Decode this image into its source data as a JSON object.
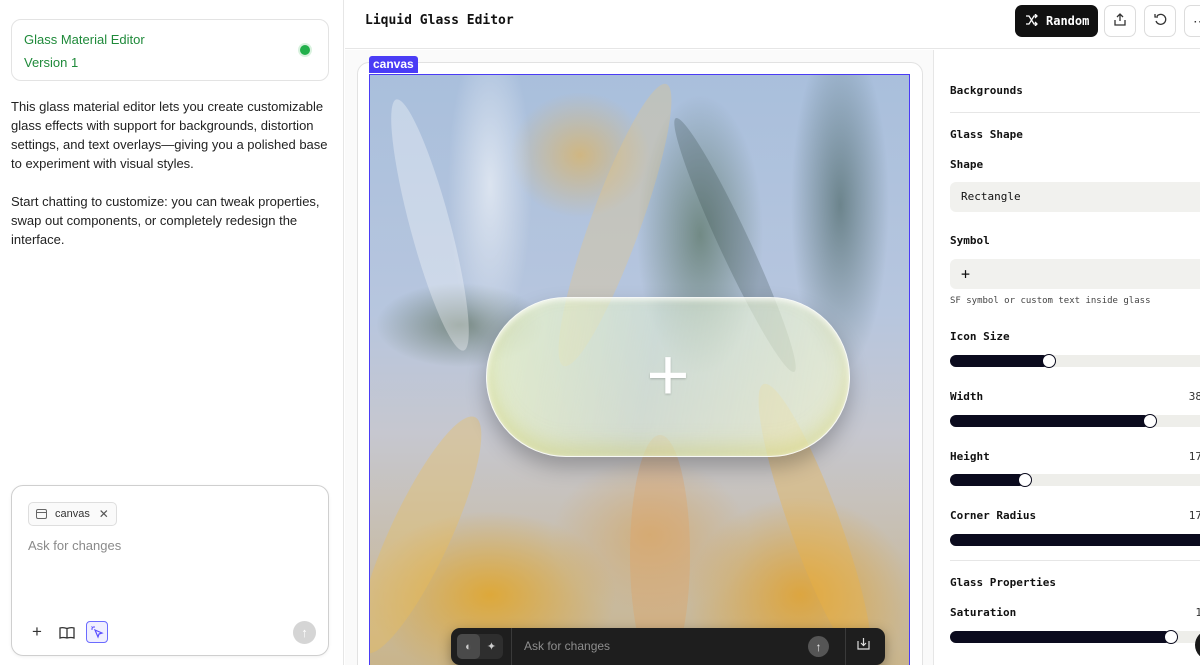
{
  "left": {
    "project_title": "Glass Material Editor",
    "project_version": "Version 1",
    "description_p1": "This glass material editor lets you create customizable glass effects with support for backgrounds, distortion settings, and text overlays—giving you a polished base to experiment with visual styles.",
    "description_p2": "Start chatting to customize: you can tweak properties, swap out components, or completely redesign the interface.",
    "chip_label": "canvas",
    "chat_placeholder": "Ask for changes",
    "status_color": "#22b04b"
  },
  "topbar": {
    "title": "Liquid Glass Editor",
    "random_label": "Random"
  },
  "canvas": {
    "tag": "canvas",
    "glass_symbol": "+",
    "float_placeholder": "Ask for changes"
  },
  "panel": {
    "backgrounds_title": "Backgrounds",
    "glass_shape_title": "Glass Shape",
    "shape_label": "Shape",
    "shape_value": "Rectangle",
    "symbol_label": "Symbol",
    "symbol_value": "+",
    "symbol_hint": "SF symbol or custom text inside glass",
    "icon_size_label": "Icon Size",
    "icon_size_fraction": 0.38,
    "width_label": "Width",
    "width_value": "38",
    "width_fraction": 0.77,
    "height_label": "Height",
    "height_value": "17",
    "height_fraction": 0.29,
    "corner_radius_label": "Corner Radius",
    "corner_radius_value": "17",
    "corner_radius_fraction": 1.0,
    "glass_properties_title": "Glass Properties",
    "saturation_label": "Saturation",
    "saturation_value": "1",
    "saturation_fraction": 0.85
  },
  "colors": {
    "accent": "#4a3cf5",
    "dark": "#0b0b1e"
  }
}
